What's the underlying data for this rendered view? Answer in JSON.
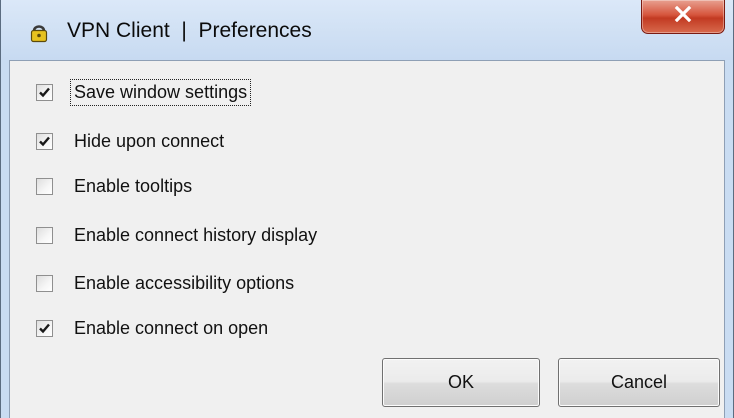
{
  "window": {
    "title": "VPN Client  |  Preferences",
    "close_icon": "close-x-icon",
    "app_icon": "vpn-padlock-icon"
  },
  "options": [
    {
      "label": "Save window settings",
      "checked": true,
      "focused": true
    },
    {
      "label": "Hide upon connect",
      "checked": true,
      "focused": false
    },
    {
      "label": "Enable tooltips",
      "checked": false,
      "focused": false
    },
    {
      "label": "Enable connect history display",
      "checked": false,
      "focused": false
    },
    {
      "label": "Enable accessibility options",
      "checked": false,
      "focused": false
    },
    {
      "label": "Enable connect on open",
      "checked": true,
      "focused": false
    }
  ],
  "buttons": {
    "ok_label": "OK",
    "cancel_label": "Cancel"
  },
  "colors": {
    "title_bar": "#c9dcf2",
    "close_button": "#c8432b",
    "dialog_body": "#f0f0f0",
    "check_mark": "#1a1a1a"
  }
}
